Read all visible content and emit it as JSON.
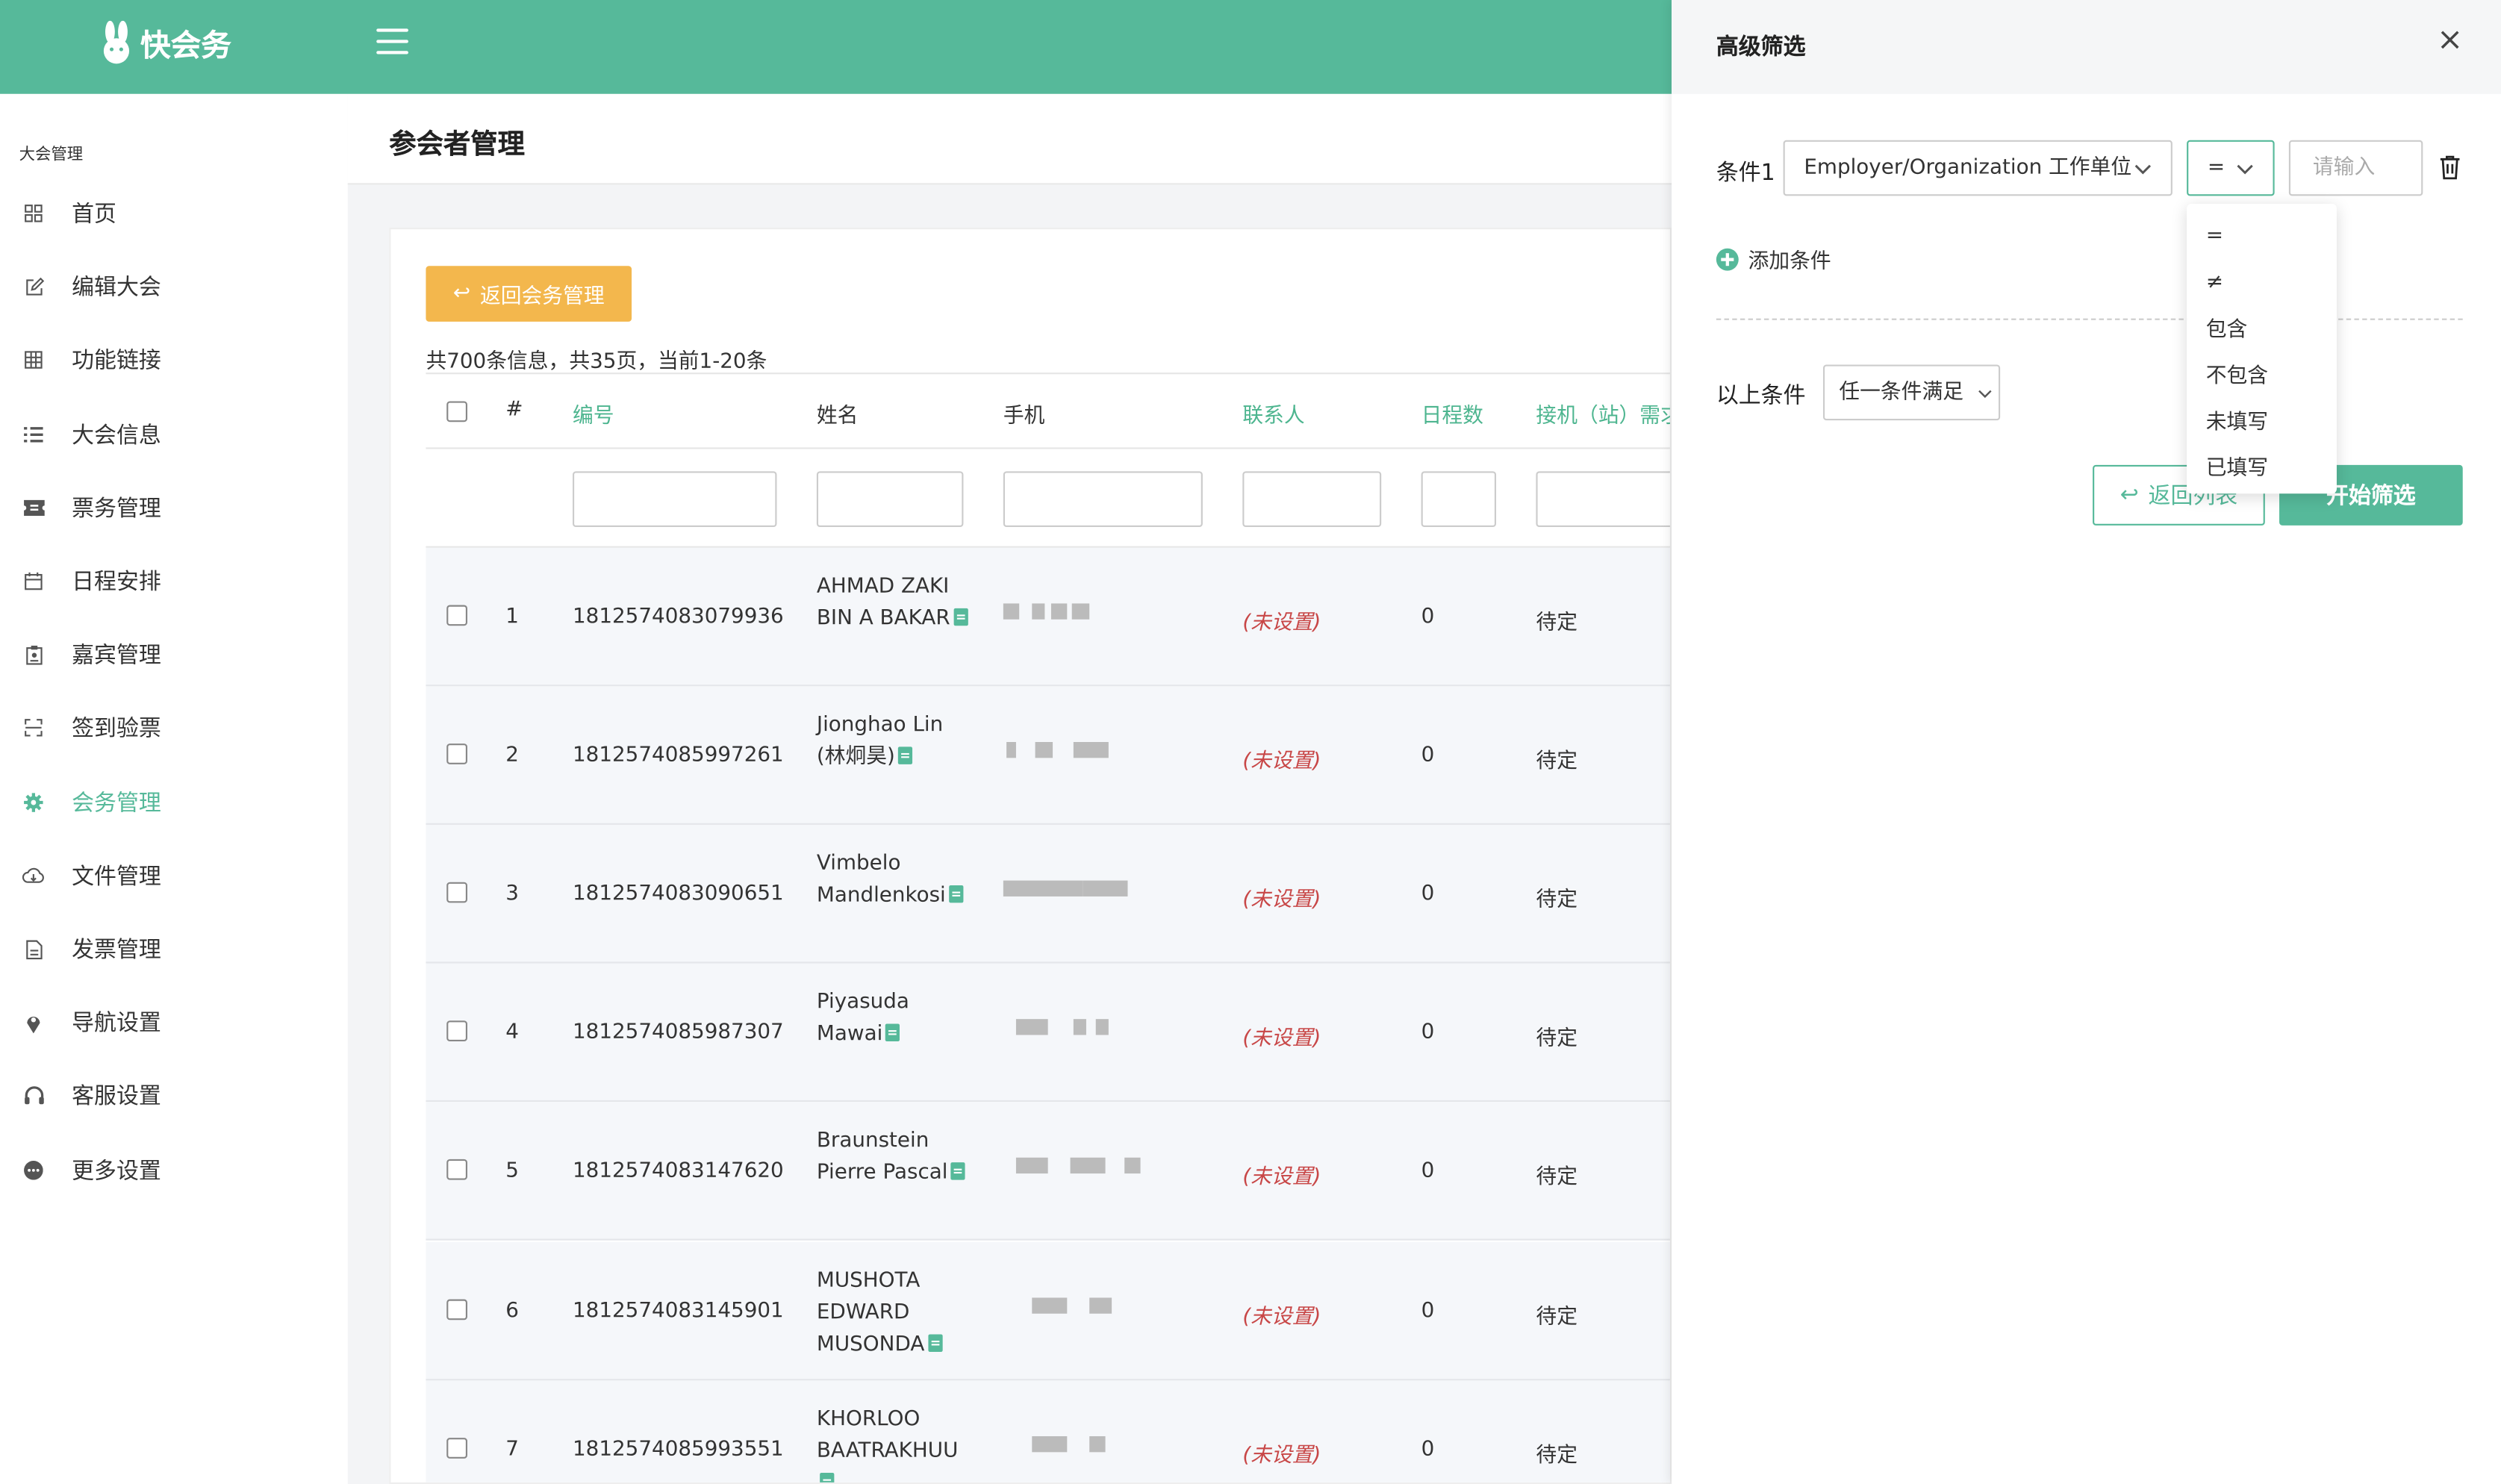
{
  "app": {
    "name": "快会务",
    "brand_color": "#56b99a",
    "warning_color": "#f3b74d",
    "danger_color": "#c84747"
  },
  "sidebar": {
    "section_title": "大会管理",
    "items": [
      {
        "label": "首页",
        "icon": "dashboard-icon"
      },
      {
        "label": "编辑大会",
        "icon": "edit-icon"
      },
      {
        "label": "功能链接",
        "icon": "grid-icon"
      },
      {
        "label": "大会信息",
        "icon": "list-icon"
      },
      {
        "label": "票务管理",
        "icon": "ticket-icon"
      },
      {
        "label": "日程安排",
        "icon": "calendar-icon"
      },
      {
        "label": "嘉宾管理",
        "icon": "badge-icon"
      },
      {
        "label": "签到验票",
        "icon": "scan-icon"
      },
      {
        "label": "会务管理",
        "icon": "gear-icon",
        "active": true
      },
      {
        "label": "文件管理",
        "icon": "cloud-icon"
      },
      {
        "label": "发票管理",
        "icon": "invoice-icon"
      },
      {
        "label": "导航设置",
        "icon": "location-pin-icon"
      },
      {
        "label": "客服设置",
        "icon": "headset-icon"
      },
      {
        "label": "更多设置",
        "icon": "more-icon"
      }
    ]
  },
  "page": {
    "title": "参会者管理"
  },
  "toolbar": {
    "back_label": "返回会务管理",
    "summary": "共700条信息，共35页，当前1-20条"
  },
  "table": {
    "headers": {
      "index": "#",
      "id": "编号",
      "name": "姓名",
      "phone": "手机",
      "contact": "联系人",
      "days": "日程数",
      "pickup": "接机（站）需求"
    },
    "rows": [
      {
        "index": "1",
        "id": "1812574083079936",
        "name": "AHMAD ZAKI BIN A BAKAR",
        "contact": "(未设置)",
        "days": "0",
        "pickup": "待定"
      },
      {
        "index": "2",
        "id": "1812574085997261",
        "name": "Jionghao Lin (林炯昊)",
        "contact": "(未设置)",
        "days": "0",
        "pickup": "待定"
      },
      {
        "index": "3",
        "id": "1812574083090651",
        "name": "Vimbelo Mandlenkosi",
        "contact": "(未设置)",
        "days": "0",
        "pickup": "待定"
      },
      {
        "index": "4",
        "id": "1812574085987307",
        "name": "Piyasuda Mawai",
        "contact": "(未设置)",
        "days": "0",
        "pickup": "待定"
      },
      {
        "index": "5",
        "id": "1812574083147620",
        "name": "Braunstein Pierre Pascal",
        "contact": "(未设置)",
        "days": "0",
        "pickup": "待定"
      },
      {
        "index": "6",
        "id": "1812574083145901",
        "name": "MUSHOTA EDWARD MUSONDA",
        "contact": "(未设置)",
        "days": "0",
        "pickup": "待定"
      },
      {
        "index": "7",
        "id": "1812574085993551",
        "name": "KHORLOO BAATRAKHUU",
        "contact": "(未设置)",
        "days": "0",
        "pickup": "待定"
      }
    ]
  },
  "filter_panel": {
    "title": "高级筛选",
    "condition_label": "条件1",
    "field_value": "Employer/Organization 工作单位",
    "operator_value": "=",
    "value_placeholder": "请输入",
    "operator_options": [
      "=",
      "≠",
      "包含",
      "不包含",
      "未填写",
      "已填写"
    ],
    "add_condition": "添加条件",
    "match_label": "以上条件",
    "match_value": "任一条件满足",
    "back_button": "返回列表",
    "apply_button": "开始筛选"
  }
}
